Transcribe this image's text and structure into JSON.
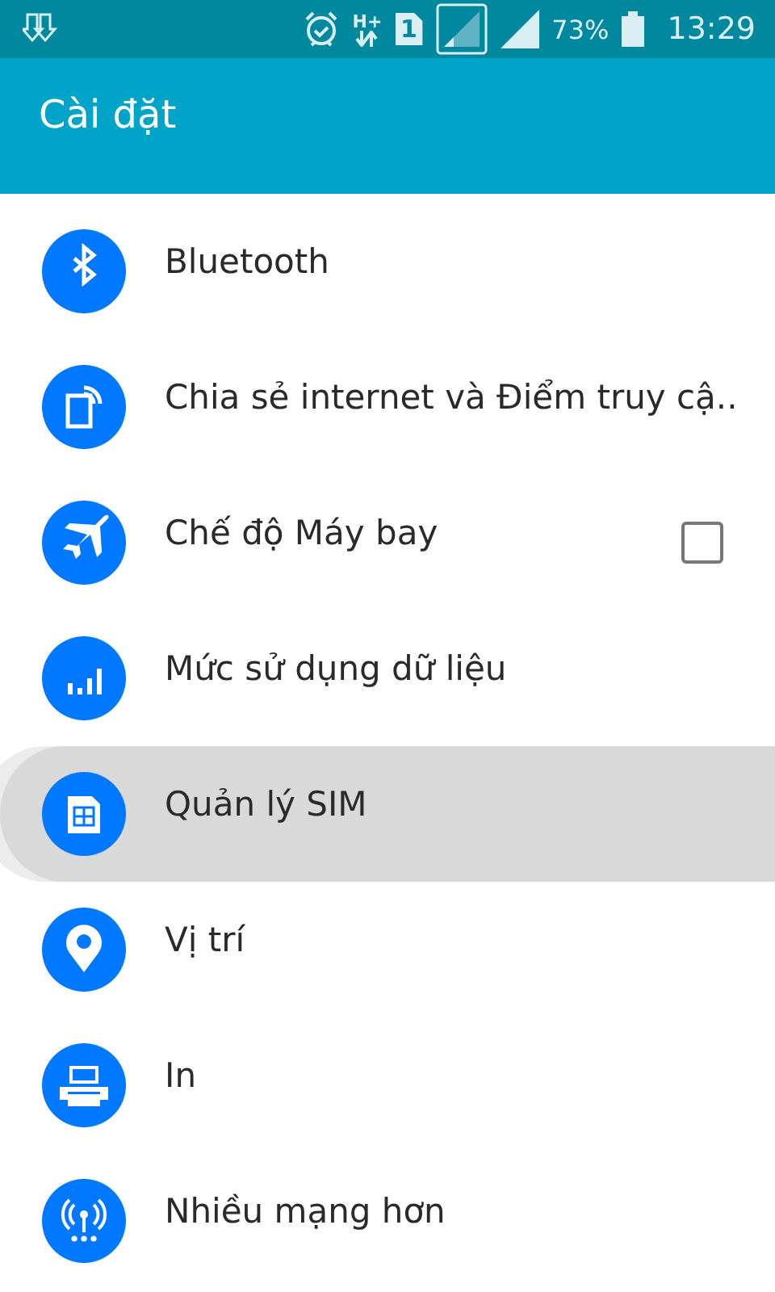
{
  "status_bar": {
    "network_type": "H+",
    "sim_slot": "1",
    "battery_percent": "73%",
    "time": "13:29"
  },
  "app_bar": {
    "title": "Cài đặt"
  },
  "items": [
    {
      "label": "Bluetooth",
      "kind": "plain",
      "selected": false
    },
    {
      "label": "Chia sẻ internet và Điểm truy cậ..",
      "kind": "plain",
      "selected": false
    },
    {
      "label": "Chế độ Máy bay",
      "kind": "checkbox",
      "checked": false,
      "selected": false
    },
    {
      "label": "Mức sử dụng dữ liệu",
      "kind": "plain",
      "selected": false
    },
    {
      "label": "Quản lý SIM",
      "kind": "plain",
      "selected": true
    },
    {
      "label": "Vị trí",
      "kind": "plain",
      "selected": false
    },
    {
      "label": "In",
      "kind": "plain",
      "selected": false
    },
    {
      "label": "Nhiều mạng hơn",
      "kind": "plain",
      "selected": false
    }
  ]
}
